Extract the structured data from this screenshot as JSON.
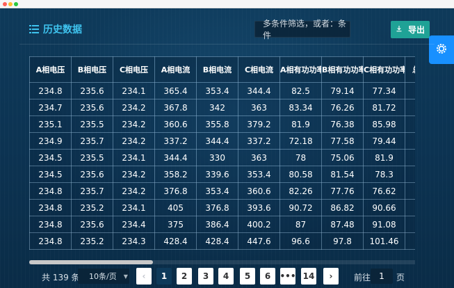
{
  "header": {
    "title": "历史数据",
    "search_placeholder": "多条件筛选，或者：条件",
    "export_label": "导出"
  },
  "table": {
    "columns": [
      "A相电压",
      "B相电压",
      "C相电压",
      "A相电流",
      "B相电流",
      "C相电流",
      "A相有功功率",
      "B相有功功率",
      "C相有功功率",
      "总"
    ],
    "rows": [
      [
        "234.8",
        "235.6",
        "234.1",
        "365.4",
        "353.4",
        "344.4",
        "82.5",
        "79.14",
        "77.34",
        ""
      ],
      [
        "234.7",
        "235.6",
        "234.2",
        "367.8",
        "342",
        "363",
        "83.34",
        "76.26",
        "81.72",
        ""
      ],
      [
        "235.1",
        "235.5",
        "234.2",
        "360.6",
        "355.8",
        "379.2",
        "81.9",
        "76.38",
        "85.98",
        ""
      ],
      [
        "234.9",
        "235.7",
        "234.2",
        "337.2",
        "344.4",
        "337.2",
        "72.18",
        "77.58",
        "79.44",
        ""
      ],
      [
        "234.5",
        "235.5",
        "234.1",
        "344.4",
        "330",
        "363",
        "78",
        "75.06",
        "81.9",
        ""
      ],
      [
        "234.5",
        "235.6",
        "234.2",
        "358.2",
        "339.6",
        "353.4",
        "80.58",
        "81.54",
        "78.3",
        ""
      ],
      [
        "234.8",
        "235.7",
        "234.2",
        "376.8",
        "353.4",
        "360.6",
        "82.26",
        "77.76",
        "76.62",
        ""
      ],
      [
        "234.8",
        "235.2",
        "234.1",
        "405",
        "376.8",
        "393.6",
        "90.72",
        "86.82",
        "90.66",
        ""
      ],
      [
        "234.8",
        "235.6",
        "234.4",
        "375",
        "386.4",
        "400.2",
        "87",
        "87.48",
        "91.08",
        ""
      ],
      [
        "234.8",
        "235.2",
        "234.3",
        "428.4",
        "428.4",
        "447.6",
        "96.6",
        "97.8",
        "101.46",
        ""
      ]
    ]
  },
  "pagination": {
    "total_label": "共 139 条",
    "page_size_label": "10条/页",
    "pages": [
      "1",
      "2",
      "3",
      "4",
      "5",
      "6",
      "•••",
      "14"
    ],
    "current_page": "1",
    "prev_icon": "‹",
    "next_icon": "›",
    "goto_label": "前往",
    "goto_value": "1",
    "goto_suffix": "页"
  },
  "icons": {
    "list": "list-icon",
    "download": "download-icon",
    "settings": "gear-icon",
    "chevron": "chevron-down-icon"
  },
  "colors": {
    "accent": "#3fc3ee",
    "export_button": "#1fa296",
    "side_tab": "#1890ff"
  }
}
